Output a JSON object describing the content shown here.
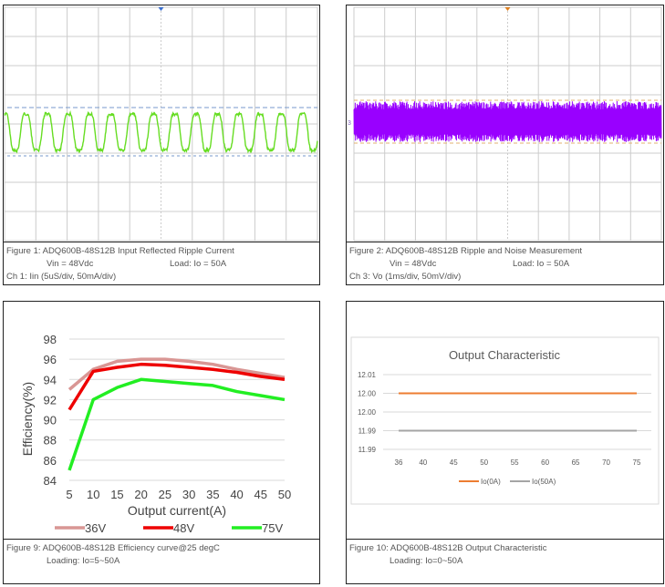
{
  "figures": [
    {
      "caption": "Figure 1: ADQ600B-48S12B Input Reflected Ripple Current",
      "vin": "Vin = 48Vdc",
      "load": "Load: Io = 50A",
      "channel": "Ch 1: Iin (5uS/div, 50mA/div)",
      "trace_color": "#66dd22"
    },
    {
      "caption": "Figure 2: ADQ600B-48S12B Ripple and Noise Measurement",
      "vin": "Vin = 48Vdc",
      "load": "Load: Io = 50A",
      "channel": "Ch 3: Vo (1ms/div, 50mV/div)",
      "trace_color": "#9900ff"
    },
    {
      "caption": "Figure 9: ADQ600B-48S12B Efficiency curve@25 degC",
      "loading": "Loading: Io=5~50A"
    },
    {
      "caption": "Figure 10: ADQ600B-48S12B Output Characteristic",
      "loading": "Loading: Io=0~50A"
    }
  ],
  "chart_data": [
    {
      "type": "line",
      "title": "",
      "xlabel": "Output current(A)",
      "ylabel": "Efficiency(%)",
      "x": [
        5,
        10,
        15,
        20,
        25,
        30,
        35,
        40,
        45,
        50
      ],
      "ylim": [
        84,
        98
      ],
      "yticks": [
        84,
        86,
        88,
        90,
        92,
        94,
        96,
        98
      ],
      "grid": true,
      "legend": "bottom",
      "series": [
        {
          "name": "36V",
          "color": "#d99694",
          "values": [
            93,
            95,
            95.8,
            96,
            96,
            95.8,
            95.5,
            95,
            94.6,
            94.2
          ]
        },
        {
          "name": "48V",
          "color": "#ee0000",
          "values": [
            91,
            94.8,
            95.2,
            95.5,
            95.4,
            95.2,
            95,
            94.7,
            94.3,
            94
          ]
        },
        {
          "name": "75V",
          "color": "#22ee22",
          "values": [
            85,
            92,
            93.2,
            94,
            93.8,
            93.6,
            93.4,
            92.8,
            92.4,
            92
          ]
        }
      ]
    },
    {
      "type": "line",
      "title": "Output Characteristic",
      "x": [
        36,
        40,
        45,
        50,
        55,
        60,
        65,
        70,
        75
      ],
      "ytick_labels": [
        "12.01",
        "12.00",
        "12.00",
        "11.99",
        "11.99"
      ],
      "ylim": [
        11.99,
        12.01
      ],
      "grid": true,
      "legend": "bottom",
      "series": [
        {
          "name": "Io(0A)",
          "color": "#ed7d31",
          "values": [
            12.005,
            12.005,
            12.005,
            12.005,
            12.005,
            12.005,
            12.005,
            12.005,
            12.005
          ]
        },
        {
          "name": "Io(50A)",
          "color": "#a5a5a5",
          "values": [
            11.995,
            11.995,
            11.995,
            11.995,
            11.995,
            11.995,
            11.995,
            11.995,
            11.995
          ]
        }
      ]
    }
  ]
}
